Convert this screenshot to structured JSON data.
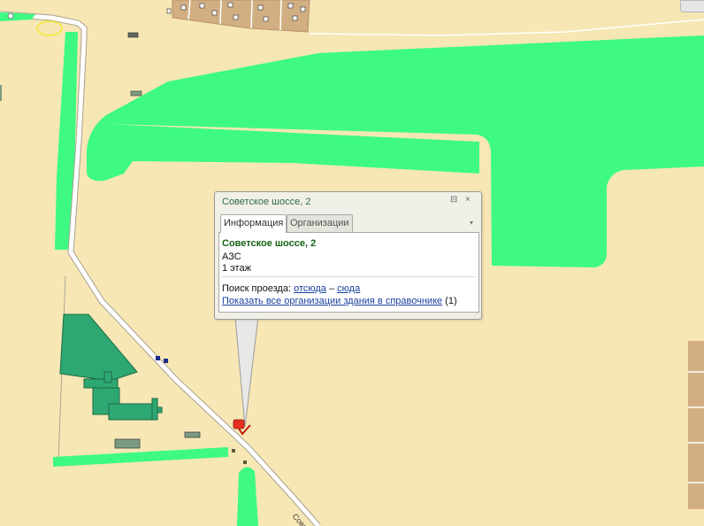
{
  "popup": {
    "title": "Советское шоссе, 2",
    "controls": {
      "pin_glyph": "⊟",
      "close_glyph": "×",
      "scroll_glyph": "▾",
      "resize_glyph": "⋰"
    },
    "tabs": [
      {
        "label": "Информация",
        "active": true
      },
      {
        "label": "Организации",
        "active": false
      }
    ],
    "body": {
      "address": "Советское шоссе, 2",
      "type": "АЗС",
      "floors": "1 этаж",
      "route_prefix": "Поиск проезда: ",
      "route_from": "отсюда",
      "route_dash": " – ",
      "route_to": "сюда",
      "show_orgs_link": "Показать все организации здания в справочнике",
      "orgs_count": " (1)"
    }
  },
  "map": {
    "road_label": "Совет",
    "colors": {
      "land": "#f6e7b5",
      "green": "#3efa82",
      "building_green": "#2ea873",
      "building_grey": "#7b9b80",
      "road": "#ffffff",
      "road_edge": "#a9a090",
      "plot": "#d2af83",
      "marker": "#e52e1f"
    },
    "icons": [
      "bus-stop-icon",
      "gas-station-marker-icon"
    ]
  }
}
